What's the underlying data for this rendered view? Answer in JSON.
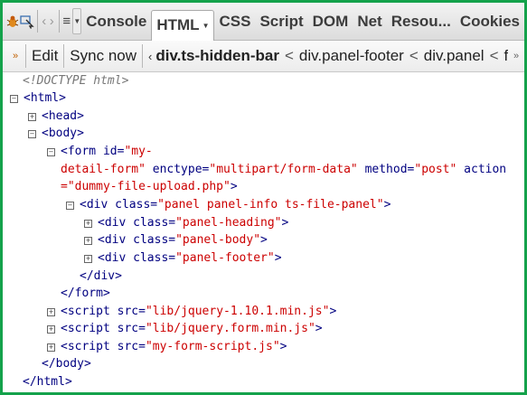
{
  "tabs": {
    "console": "Console",
    "html": "HTML",
    "css": "CSS",
    "script": "Script",
    "dom": "DOM",
    "net": "Net",
    "resources": "Resou...",
    "cookies": "Cookies"
  },
  "toolbar": {
    "edit": "Edit",
    "sync": "Sync now",
    "breadcrumb_lead": "‹",
    "breadcrumbs": [
      "div.ts-hidden-bar",
      "div.panel-footer",
      "div.panel",
      "fo"
    ],
    "crumb_sep": "<"
  },
  "tree": {
    "doctype": "<!DOCTYPE html>",
    "html_open": "<html>",
    "head": "<head>",
    "body_open": "<body>",
    "form_open_1": "<form",
    "form_id_name": "id=",
    "form_id_val_1": "\"my-",
    "form_id_val_2": "detail-form\"",
    "form_enc_name": "enctype=",
    "form_enc_val": "\"multipart/form-data\"",
    "form_method_name": "method=",
    "form_method_val": "\"post\"",
    "form_action_name": "action",
    "form_action_val": "=\"dummy-file-upload.php\"",
    "form_close_bracket": ">",
    "div_panel_open": "<div",
    "div_panel_attr": "class=",
    "div_panel_val": "\"panel panel-info ts-file-panel\"",
    "div_heading_val": "\"panel-heading\"",
    "div_body_val": "\"panel-body\"",
    "div_footer_val": "\"panel-footer\"",
    "div_close": "</div>",
    "form_close": "</form>",
    "script_open": "<script",
    "script_src": "src=",
    "script1_val": "\"lib/jquery-1.10.1.min.js\"",
    "script2_val": "\"lib/jquery.form.min.js\"",
    "script3_val": "\"my-form-script.js\"",
    "body_close": "</body>",
    "html_close": "</html>",
    "gt": ">"
  },
  "colors": {
    "frame_border": "#14a24b",
    "tag": "#000080",
    "attr_value": "#cc0000",
    "doctype": "#777777"
  }
}
